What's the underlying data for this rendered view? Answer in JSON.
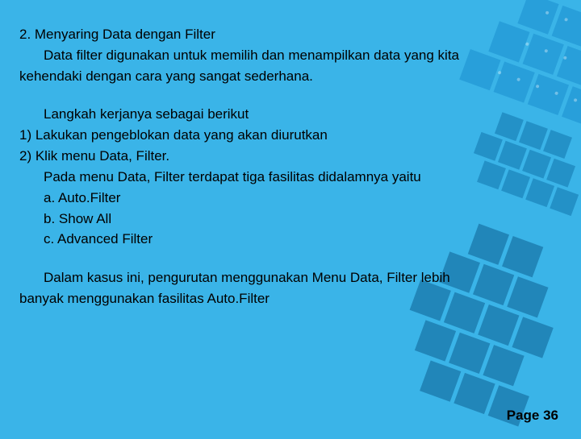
{
  "main": {
    "heading": "2. Menyaring Data dengan Filter",
    "intro1": "Data filter digunakan untuk memilih dan menampilkan data yang kita",
    "intro2": "kehendaki dengan cara  yang sangat sederhana.",
    "steps_intro": "Langkah kerjanya sebagai berikut",
    "step1": "1) Lakukan pengeblokan data yang akan diurutkan",
    "step2": "2) Klik menu Data, Filter.",
    "step2_note": "Pada menu Data, Filter terdapat tiga fasilitas didalamnya yaitu",
    "opt_a": "a. Auto.Filter",
    "opt_b": "b. Show All",
    "opt_c": "c. Advanced Filter",
    "closing1": "Dalam kasus ini, pengurutan menggunakan Menu Data, Filter lebih",
    "closing2": "banyak menggunakan fasilitas Auto.Filter"
  },
  "footer": {
    "page_label": "Page 36"
  }
}
